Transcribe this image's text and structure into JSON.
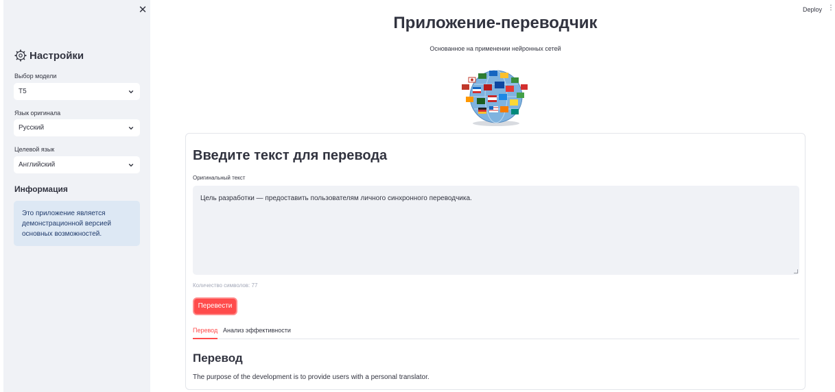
{
  "sidebar": {
    "close_icon": "close-icon",
    "title": "Настройки",
    "title_icon": "gear-icon",
    "model": {
      "label": "Выбор модели",
      "value": "T5"
    },
    "source_lang": {
      "label": "Язык оригинала",
      "value": "Русский"
    },
    "target_lang": {
      "label": "Целевой язык",
      "value": "Английский"
    },
    "info": {
      "heading": "Информация",
      "text": "Это приложение является демонстрационной версией основных возможностей."
    }
  },
  "header": {
    "deploy": "Deploy",
    "menu_icon": "vertical-dots-icon"
  },
  "main": {
    "title": "Приложение-переводчик",
    "subtitle": "Основанное на применении нейронных сетей",
    "image": "globe-with-flags",
    "card": {
      "title": "Введите текст для перевода",
      "input_label": "Оригинальный текст",
      "input_value": "Цель разработки — предоставить пользователям личного синхронного переводчика.",
      "char_count": "Количество символов: 77",
      "translate_button": "Перевести",
      "tabs": [
        {
          "label": "Перевод",
          "active": true
        },
        {
          "label": "Анализ эффективности",
          "active": false
        }
      ],
      "result_heading": "Перевод",
      "result_text": "The purpose of the development is to provide users with a personal translator."
    }
  },
  "colors": {
    "primary": "#ff4b4b",
    "sidebar_bg": "#f0f2f6",
    "info_bg": "#dde8f4",
    "text": "#31333f"
  }
}
